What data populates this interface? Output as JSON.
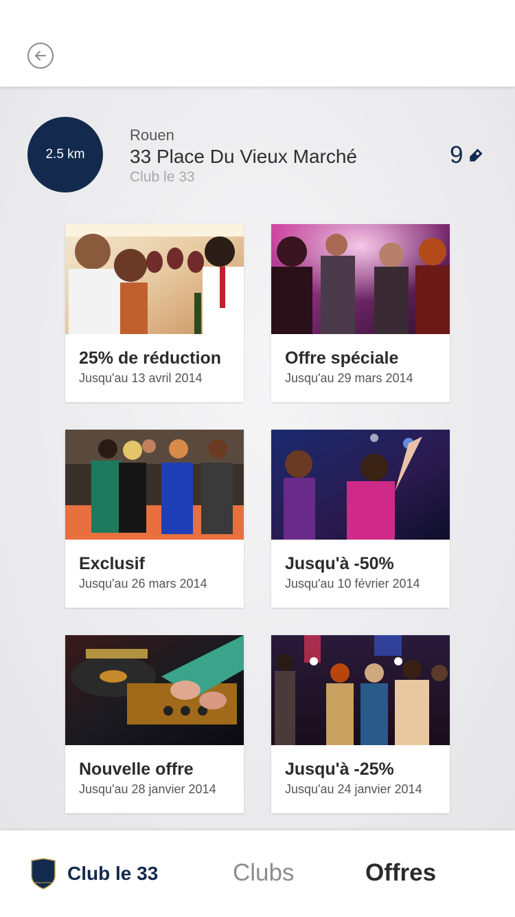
{
  "header": {
    "back_icon": "arrow-left-icon"
  },
  "venue": {
    "distance": "2.5 km",
    "city": "Rouen",
    "address": "33 Place Du Vieux Marché",
    "club": "Club le 33",
    "offer_count": "9",
    "tag_icon": "price-tag-icon"
  },
  "offers": [
    {
      "title": "25% de réduction",
      "date": "Jusqu'au 13 avril 2014",
      "image": "people-toasting-wine"
    },
    {
      "title": "Offre spéciale",
      "date": "Jusqu'au 29 mars 2014",
      "image": "party-crowd-drinks"
    },
    {
      "title": "Exclusif",
      "date": "Jusqu'au 26 mars 2014",
      "image": "women-at-bar"
    },
    {
      "title": "Jusqu'à -50%",
      "date": "Jusqu'au 10 février 2014",
      "image": "women-dancing-club"
    },
    {
      "title": "Nouvelle offre",
      "date": "Jusqu'au 28 janvier 2014",
      "image": "dj-turntable"
    },
    {
      "title": "Jusqu'à -25%",
      "date": "Jusqu'au 24 janvier 2014",
      "image": "crowd-dancing-lights"
    }
  ],
  "nav": {
    "brand_label": "Club le 33",
    "brand_icon": "club-33-shield-logo",
    "clubs_label": "Clubs",
    "offres_label": "Offres"
  },
  "colors": {
    "primary": "#132a4e",
    "background": "#ececee",
    "card": "#ffffff"
  }
}
